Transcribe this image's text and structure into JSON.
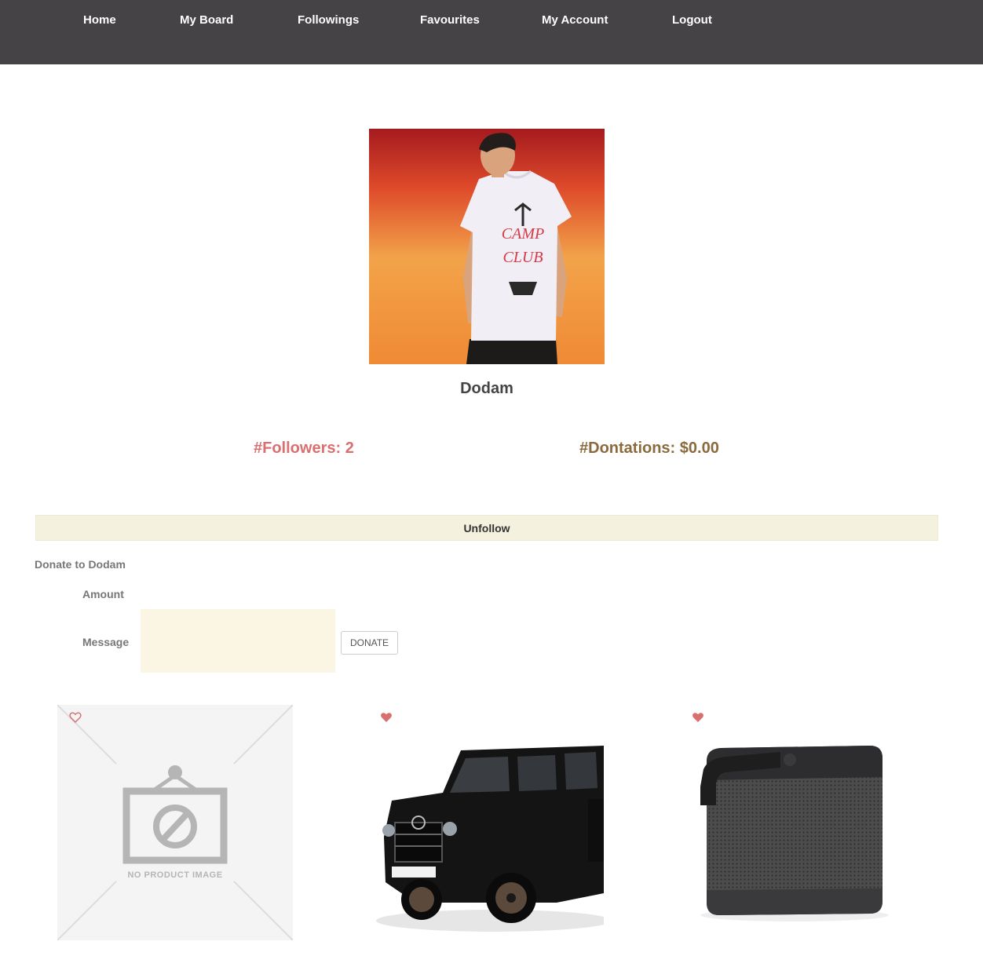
{
  "nav": {
    "items": [
      {
        "label": "Home"
      },
      {
        "label": "My Board"
      },
      {
        "label": "Followings"
      },
      {
        "label": "Favourites"
      },
      {
        "label": "My Account"
      },
      {
        "label": "Logout"
      }
    ]
  },
  "profile": {
    "name": "Dodam",
    "followers": "#Followers: 2",
    "donations": "#Dontations: $0.00"
  },
  "actions": {
    "unfollow_label": "Unfollow"
  },
  "donate": {
    "title": "Donate to Dodam",
    "amount_label": "Amount",
    "message_label": "Message",
    "message_value": "",
    "button_label": "DONATE"
  },
  "products": [
    {
      "image": "no-product-image",
      "placeholder_text": "NO PRODUCT IMAGE",
      "favourited": false
    },
    {
      "image": "black-suv",
      "favourited": true
    },
    {
      "image": "bluetooth-speaker",
      "favourited": true
    }
  ],
  "colors": {
    "nav_bg": "#454345",
    "followers": "#d9706f",
    "donations": "#8b6a3d",
    "unfollow_bg": "#f4f2de",
    "heart": "#d9706f"
  }
}
